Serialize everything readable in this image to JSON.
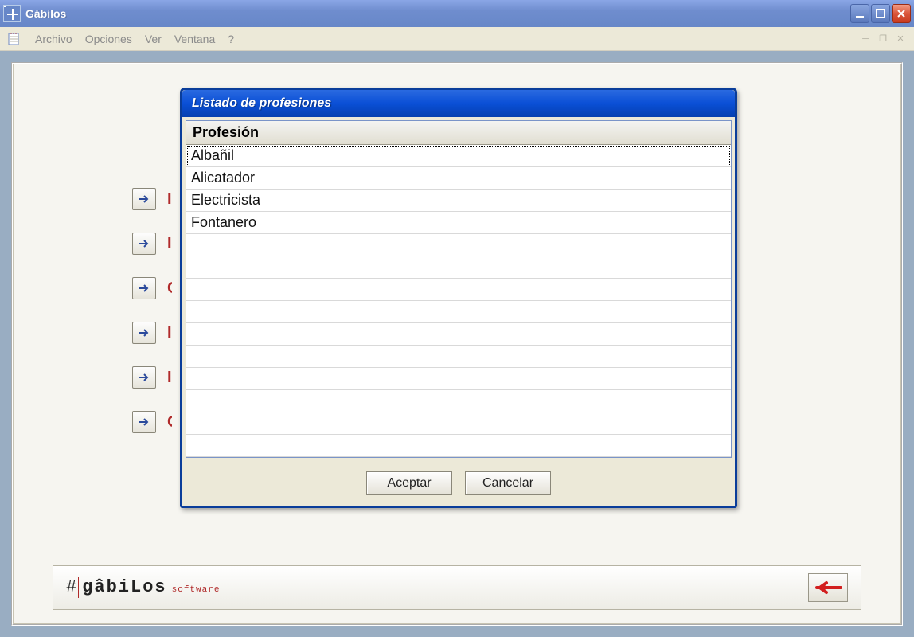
{
  "window": {
    "title": "Gábilos"
  },
  "menu": {
    "items": [
      "Archivo",
      "Opciones",
      "Ver",
      "Ventana",
      "?"
    ]
  },
  "logo": {
    "name": "gâbiLos",
    "sub": "software"
  },
  "dialog": {
    "title": "Listado de profesiones",
    "column_header": "Profesión",
    "rows": [
      "Albañil",
      "Alicatador",
      "Electricista",
      "Fontanero"
    ],
    "empty_row_count": 10,
    "selected_index": 0,
    "buttons": {
      "accept": "Aceptar",
      "cancel": "Cancelar"
    }
  }
}
